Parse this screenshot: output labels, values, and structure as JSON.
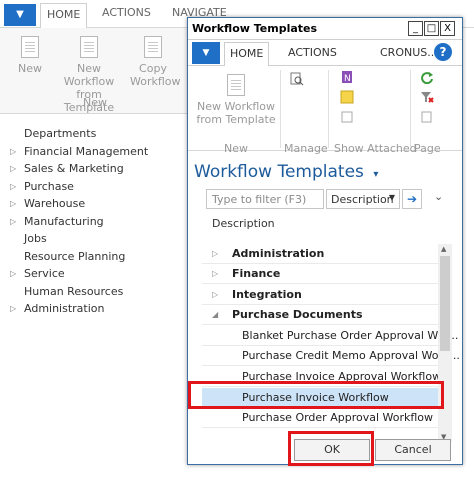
{
  "background": {
    "app_button": "▼",
    "tabs": [
      "HOME",
      "ACTIONS",
      "NAVIGATE"
    ],
    "ribbon": {
      "new_label": "New",
      "new_from_template_label": "New Workflow from Template",
      "copy_workflow_label": "Copy Workflow",
      "group_label": "New"
    },
    "nav_items": [
      {
        "label": "Departments",
        "expandable": false
      },
      {
        "label": "Financial Management",
        "expandable": true
      },
      {
        "label": "Sales & Marketing",
        "expandable": true
      },
      {
        "label": "Purchase",
        "expandable": true
      },
      {
        "label": "Warehouse",
        "expandable": true
      },
      {
        "label": "Manufacturing",
        "expandable": true
      },
      {
        "label": "Jobs",
        "expandable": false
      },
      {
        "label": "Resource Planning",
        "expandable": false
      },
      {
        "label": "Service",
        "expandable": true
      },
      {
        "label": "Human Resources",
        "expandable": false
      },
      {
        "label": "Administration",
        "expandable": true
      }
    ]
  },
  "dialog": {
    "title": "Workflow Templates",
    "window_buttons": {
      "minimize": "_",
      "maximize": "□",
      "close": "X"
    },
    "app_button": "▼",
    "tabs": {
      "home": "HOME",
      "actions": "ACTIONS",
      "company": "CRONUS..."
    },
    "help": "?",
    "ribbon": {
      "new_workflow_from_template": "New Workflow from Template",
      "new_group": "New",
      "manage": "Manage",
      "show_attached": "Show Attached",
      "page": "Page"
    },
    "page_title": "Workflow Templates",
    "filter_placeholder": "Type to filter (F3)",
    "filter_field": "Description",
    "column_header": "Description",
    "rows": [
      {
        "label": "Administration",
        "type": "group",
        "expanded": false
      },
      {
        "label": "Finance",
        "type": "group",
        "expanded": false
      },
      {
        "label": "Integration",
        "type": "group",
        "expanded": false
      },
      {
        "label": "Purchase Documents",
        "type": "group",
        "expanded": true
      },
      {
        "label": "Blanket Purchase Order Approval Wor...",
        "type": "child"
      },
      {
        "label": "Purchase Credit Memo Approval Work...",
        "type": "child"
      },
      {
        "label": "Purchase Invoice Approval Workflow",
        "type": "child"
      },
      {
        "label": "Purchase Invoice Workflow",
        "type": "child",
        "selected": true
      },
      {
        "label": "Purchase Order Approval Workflow",
        "type": "child"
      }
    ],
    "ok_label": "OK",
    "cancel_label": "Cancel",
    "highlight_color": "#e0161a",
    "accent_color": "#1e6fc5"
  }
}
